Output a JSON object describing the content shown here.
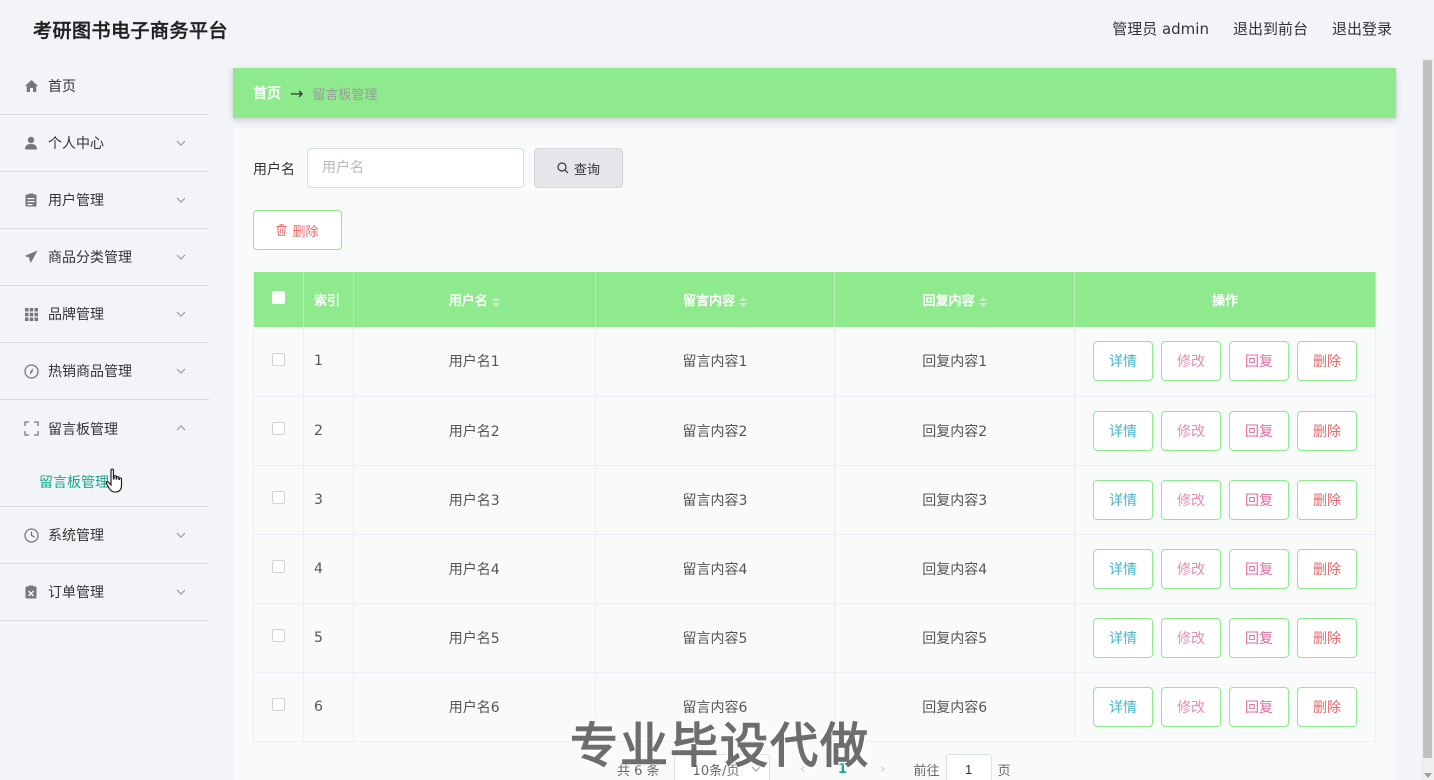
{
  "header": {
    "title": "考研图书电子商务平台",
    "links": [
      "管理员 admin",
      "退出到前台",
      "退出登录"
    ]
  },
  "sidebar": {
    "items": [
      {
        "label": "首页",
        "icon": "home-icon",
        "expandable": false
      },
      {
        "label": "个人中心",
        "icon": "user-icon",
        "expandable": true
      },
      {
        "label": "用户管理",
        "icon": "clipboard-icon",
        "expandable": true
      },
      {
        "label": "商品分类管理",
        "icon": "send-icon",
        "expandable": true
      },
      {
        "label": "品牌管理",
        "icon": "grid-icon",
        "expandable": true
      },
      {
        "label": "热销商品管理",
        "icon": "compass-icon",
        "expandable": true
      },
      {
        "label": "留言板管理",
        "icon": "fullscreen-icon",
        "expandable": true,
        "expanded": true
      },
      {
        "label": "系统管理",
        "icon": "clock-icon",
        "expandable": true
      },
      {
        "label": "订单管理",
        "icon": "delete-box-icon",
        "expandable": true
      }
    ],
    "submenu": {
      "label": "留言板管理",
      "active": true
    }
  },
  "breadcrumb": {
    "home": "首页",
    "arrow": "→",
    "current": "留言板管理"
  },
  "search": {
    "label": "用户名",
    "placeholder": "用户名",
    "value": "",
    "button": "查询"
  },
  "toolbar": {
    "delete_label": "删除"
  },
  "table": {
    "columns": [
      "",
      "索引",
      "用户名",
      "留言内容",
      "回复内容",
      "操作"
    ],
    "rows": [
      {
        "index": "1",
        "username": "用户名1",
        "message": "留言内容1",
        "reply": "回复内容1"
      },
      {
        "index": "2",
        "username": "用户名2",
        "message": "留言内容2",
        "reply": "回复内容2"
      },
      {
        "index": "3",
        "username": "用户名3",
        "message": "留言内容3",
        "reply": "回复内容3"
      },
      {
        "index": "4",
        "username": "用户名4",
        "message": "留言内容4",
        "reply": "回复内容4"
      },
      {
        "index": "5",
        "username": "用户名5",
        "message": "留言内容5",
        "reply": "回复内容5"
      },
      {
        "index": "6",
        "username": "用户名6",
        "message": "留言内容6",
        "reply": "回复内容6"
      }
    ],
    "actions": {
      "detail": "详情",
      "edit": "修改",
      "reply": "回复",
      "delete": "删除"
    }
  },
  "pagination": {
    "total": "共 6 条",
    "page_size": "10条/页",
    "current_page": "1",
    "goto_label": "前往",
    "goto_value": "1",
    "goto_unit": "页"
  },
  "watermark": "专业毕设代做",
  "colors": {
    "accent_green": "#8eea8d",
    "active_teal": "#16a78e",
    "detail": "#45b6c7",
    "edit": "#e58db6",
    "reply": "#e26ba0",
    "delete": "#e4686e"
  }
}
